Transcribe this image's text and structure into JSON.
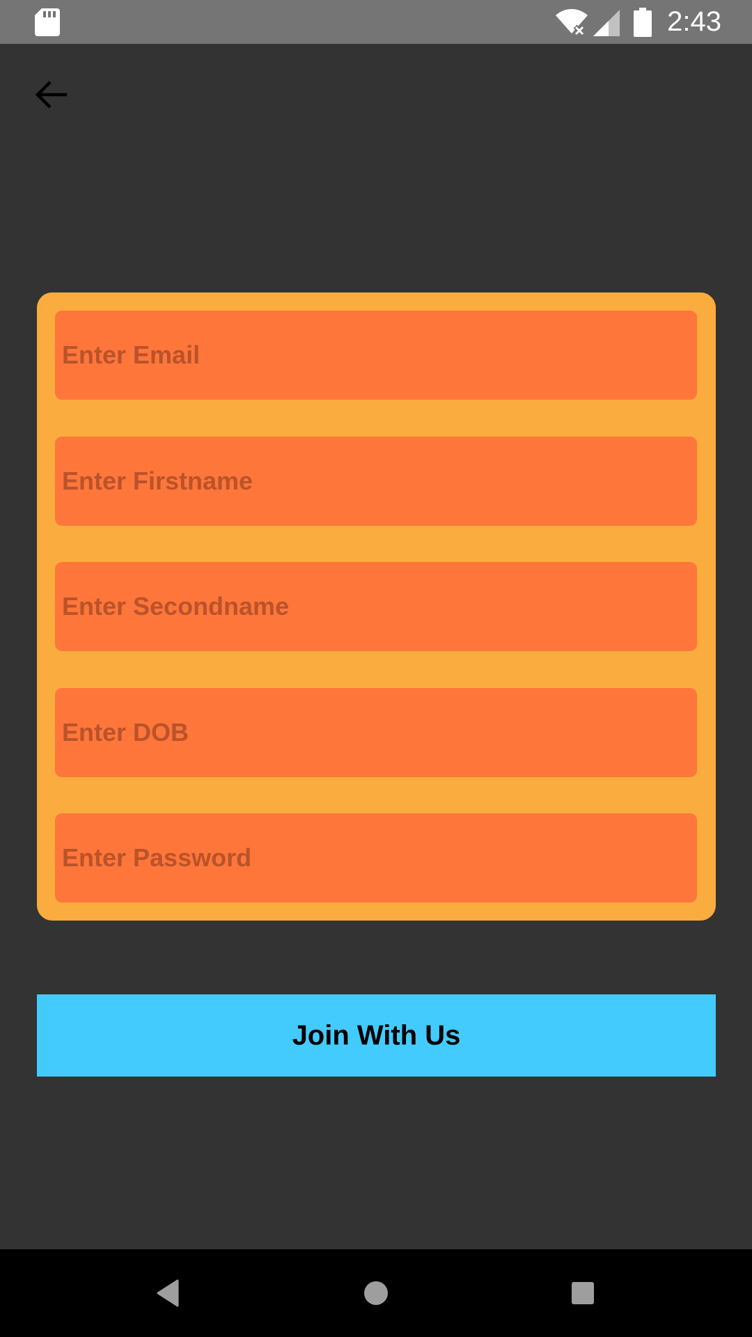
{
  "status_bar": {
    "time": "2:43",
    "icons": [
      "sd-card-icon",
      "wifi-off-icon",
      "cell-signal-icon",
      "battery-icon"
    ]
  },
  "toolbar": {
    "back_icon": "arrow-left-icon"
  },
  "form": {
    "fields": [
      {
        "placeholder": "Enter Email",
        "value": ""
      },
      {
        "placeholder": "Enter Firstname",
        "value": ""
      },
      {
        "placeholder": "Enter Secondname",
        "value": ""
      },
      {
        "placeholder": "Enter DOB",
        "value": ""
      },
      {
        "placeholder": "Enter Password",
        "value": ""
      }
    ]
  },
  "join_button": {
    "label": "Join With Us"
  },
  "colors": {
    "background": "#333333",
    "card": "#FBAC3F",
    "field": "#FF763B",
    "placeholder": "#B9532A",
    "button": "#43CBFE"
  },
  "nav_bar": {
    "icons": [
      "back-triangle-icon",
      "home-circle-icon",
      "recents-square-icon"
    ]
  }
}
